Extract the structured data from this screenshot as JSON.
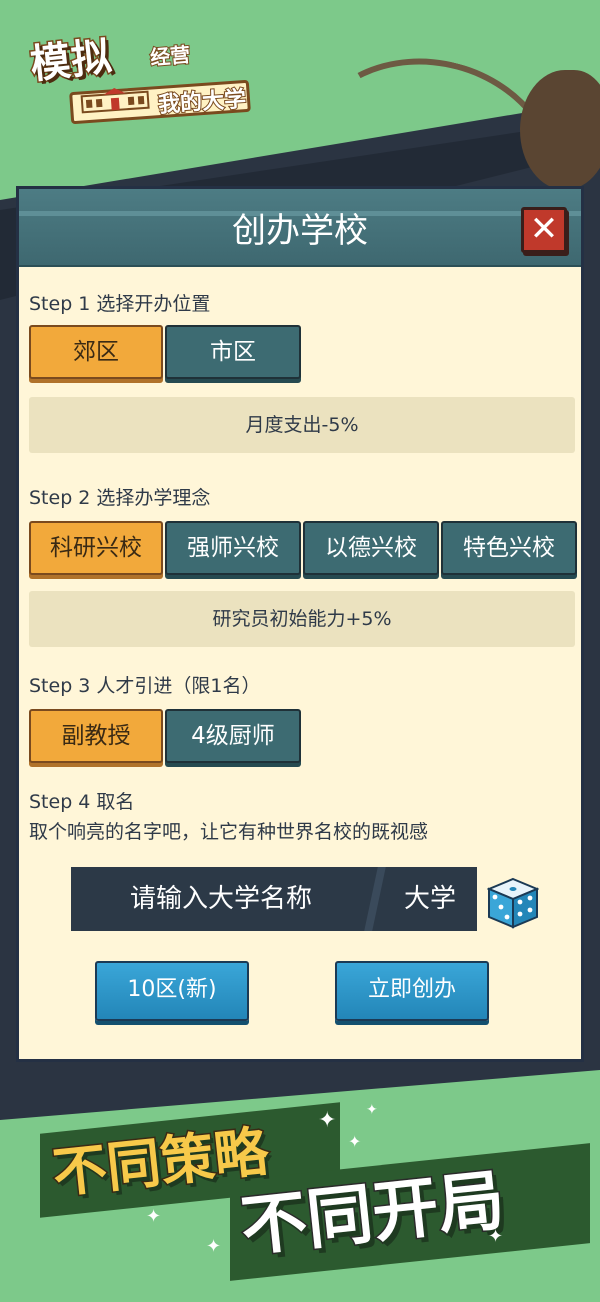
{
  "logo": {
    "title_big": "模拟",
    "title_small_a": "经营",
    "title_small_b": "我的大学",
    "building_icon": "school-building-icon"
  },
  "panel": {
    "title": "创办学校",
    "close_label": "✕"
  },
  "step1": {
    "label": "Step 1 选择开办位置",
    "options": [
      "郊区",
      "市区"
    ],
    "selected": "郊区",
    "description": "月度支出-5%"
  },
  "step2": {
    "label": "Step 2 选择办学理念",
    "options": [
      "科研兴校",
      "强师兴校",
      "以德兴校",
      "特色兴校"
    ],
    "selected": "科研兴校",
    "description": "研究员初始能力+5%"
  },
  "step3": {
    "label": "Step 3 人才引进（限1名）",
    "options": [
      "副教授",
      "4级厨师"
    ],
    "selected": "副教授"
  },
  "step4": {
    "label": "Step 4 取名",
    "hint": "取个响亮的名字吧，让它有种世界名校的既视感",
    "placeholder": "请输入大学名称",
    "suffix": "大学",
    "dice_icon": "dice-icon"
  },
  "actions": {
    "server": "10区(新)",
    "create": "立即创办"
  },
  "slogan": {
    "line1": "不同策略",
    "line2": "不同开局"
  },
  "colors": {
    "selected": "#f2a93b",
    "unselected": "#3d6b72",
    "action": "#2d95c8",
    "close": "#c0392b",
    "background": "#7dc98a"
  }
}
